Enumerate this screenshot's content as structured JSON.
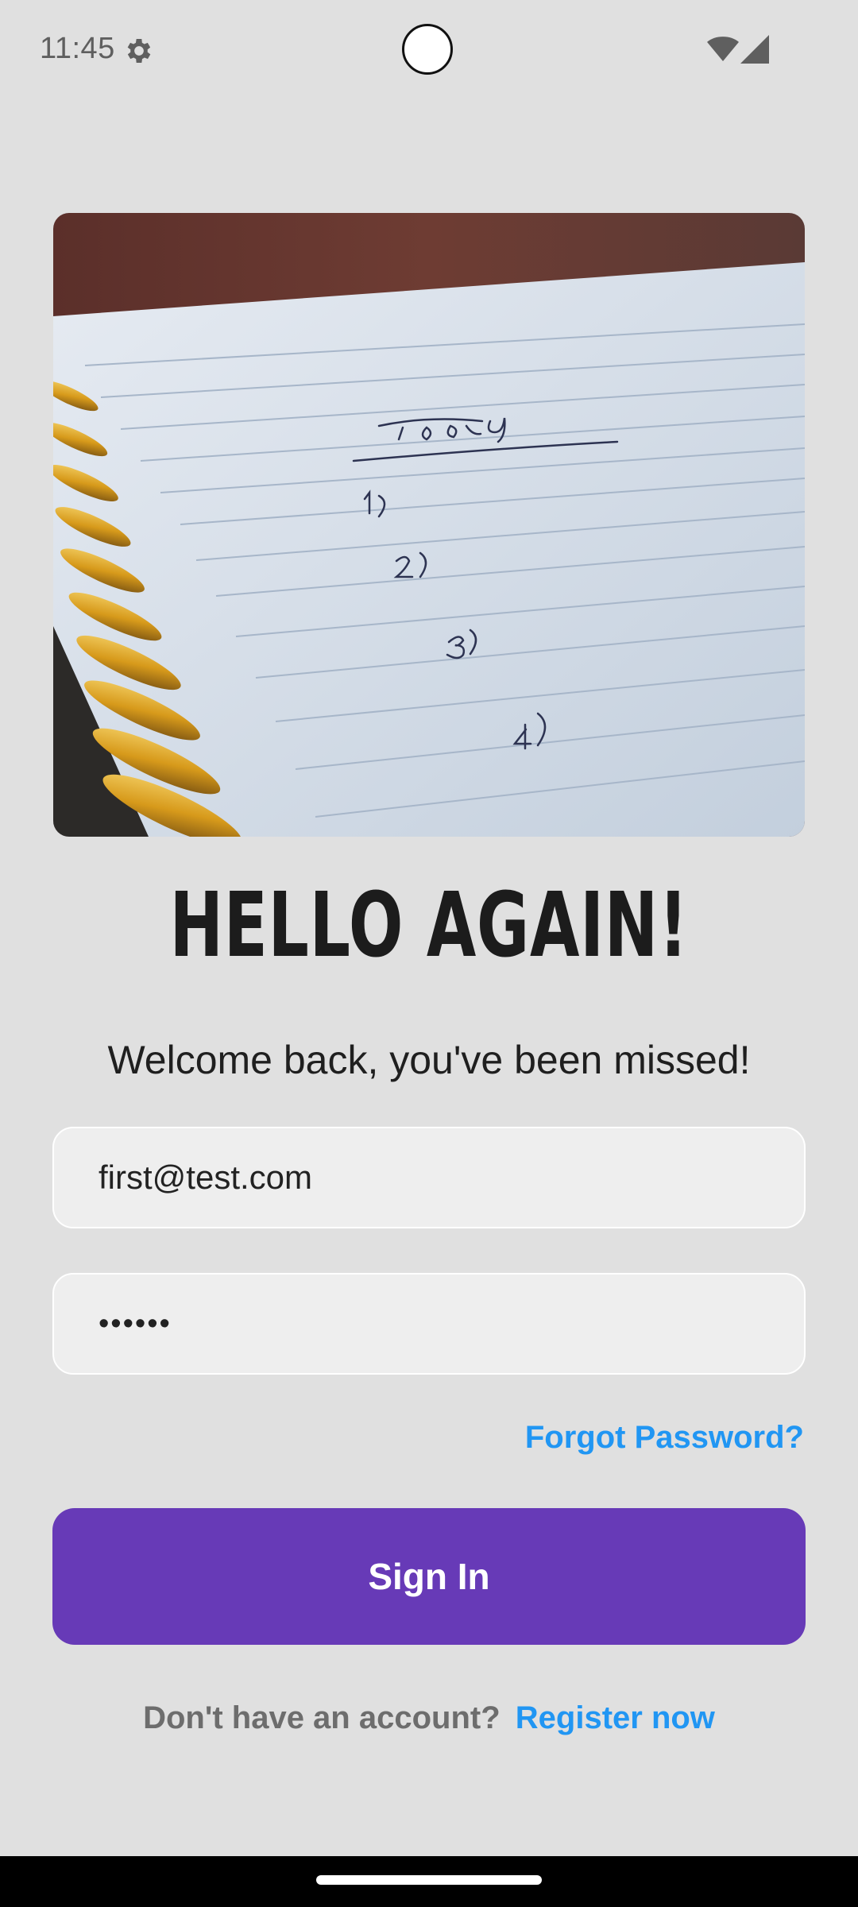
{
  "status_bar": {
    "time": "11:45",
    "icons": [
      "settings-icon",
      "wifi-icon",
      "signal-icon"
    ]
  },
  "hero_image": {
    "description_icon": "notebook-image",
    "handwriting": {
      "heading": "Today",
      "items": [
        "1)",
        "2)",
        "3)",
        "4)"
      ]
    }
  },
  "login": {
    "title": "HELLO AGAIN!",
    "subtitle": "Welcome back, you've been missed!",
    "email_value": "first@test.com",
    "password_value": "••••••",
    "forgot_label": "Forgot Password?",
    "signin_label": "Sign In",
    "register_prompt": "Don't have an account?",
    "register_link": "Register now"
  },
  "colors": {
    "background": "#e0e0e0",
    "primary": "#673ab7",
    "link": "#2196f3"
  }
}
